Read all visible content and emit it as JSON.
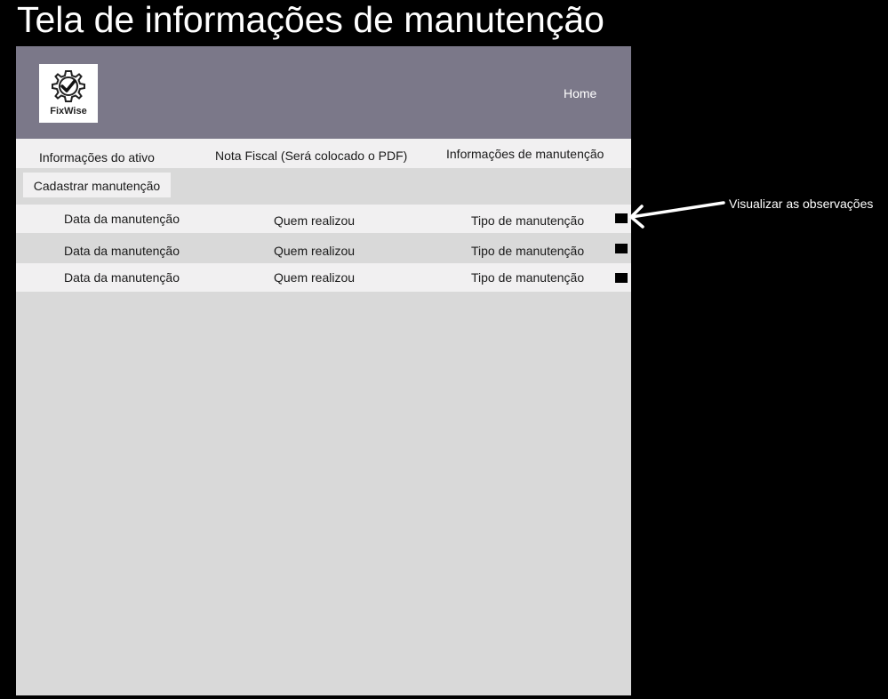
{
  "page_title": "Tela de informações de manutenção",
  "header": {
    "logo_text": "FixWise",
    "logo_icon": "gear-check-icon",
    "home_label": "Home",
    "background": "#7b7889"
  },
  "tabs": [
    {
      "label": "Informações do ativo"
    },
    {
      "label": "Nota Fiscal (Será colocado o PDF)"
    },
    {
      "label": "Informações de manutenção"
    }
  ],
  "register_button_label": "Cadastrar manutenção",
  "rows": [
    {
      "date": "Data da manutenção",
      "who": "Quem realizou",
      "type": "Tipo de manutenção",
      "view_icon": "view-observations-icon"
    },
    {
      "date": "Data da manutenção",
      "who": "Quem realizou",
      "type": "Tipo de manutenção",
      "view_icon": "view-observations-icon"
    },
    {
      "date": "Data da manutenção",
      "who": "Quem realizou",
      "type": "Tipo de manutenção",
      "view_icon": "view-observations-icon"
    }
  ],
  "annotation": {
    "text": "Visualizar as observações",
    "icon": "arrow-left-icon"
  },
  "colors": {
    "background": "#000000",
    "frame": "#d9d9d9",
    "row_light": "#f1f0f1"
  }
}
